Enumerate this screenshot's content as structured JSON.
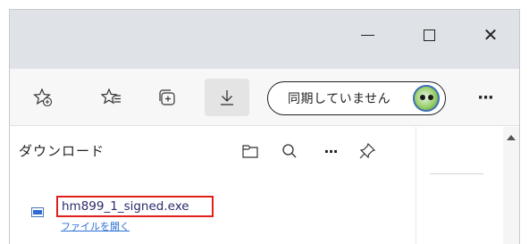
{
  "window": {
    "minimize_label": "",
    "maximize_label": "",
    "close_glyph": "✕"
  },
  "toolbar": {
    "sync_text": "同期していません",
    "more_glyph": "···",
    "icons": [
      "add-favorite-icon",
      "favorites-icon",
      "collections-icon",
      "download-icon",
      "avatar-icon",
      "more-icon"
    ]
  },
  "downloads": {
    "title": "ダウンロード",
    "more_glyph": "···",
    "items": [
      {
        "filename": "hm899_1_signed.exe",
        "action": "ファイルを開く"
      }
    ]
  },
  "colors": {
    "highlight_border": "#e0201d",
    "link": "#2a6fd6",
    "titlebar": "#dfe3e8"
  }
}
